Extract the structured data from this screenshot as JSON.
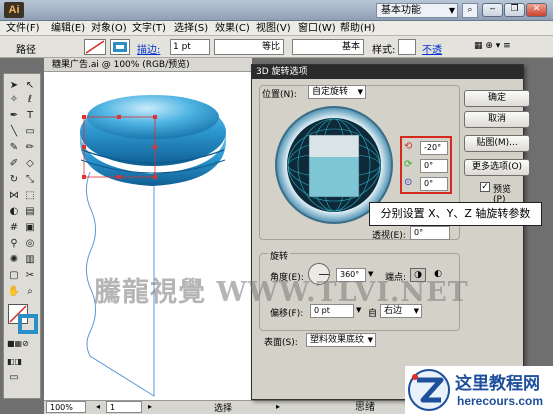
{
  "app": {
    "logo": "Ai",
    "workspace": "基本功能"
  },
  "menu": [
    "文件(F)",
    "编辑(E)",
    "对象(O)",
    "文字(T)",
    "选择(S)",
    "效果(C)",
    "视图(V)",
    "窗口(W)",
    "帮助(H)"
  ],
  "options": {
    "object_type": "路径",
    "stroke_label": "描边:",
    "stroke_weight": "1 pt",
    "profile": "等比",
    "brush": "基本",
    "style_label": "样式:",
    "opacity_link": "不透"
  },
  "document": {
    "tab_title": "糖果广告.ai @ 100% (RGB/预览)",
    "zoom": "100%",
    "page": "1",
    "status_tool": "选择"
  },
  "dialog": {
    "title": "3D 旋转选项",
    "position_label": "位置(N):",
    "position_value": "自定旋转",
    "x_value": "-20°",
    "y_value": "0°",
    "z_value": "0°",
    "perspective_label": "透视(E):",
    "perspective_value": "0°",
    "shading_section": "旋转",
    "angle_label": "角度(E):",
    "angle_value": "360°",
    "cap_label": "端点:",
    "bevel_label": "偏移(F):",
    "bevel_value": "0 pt",
    "bevel_from": "自",
    "bevel_side": "右边",
    "surface_label": "表面(S):",
    "surface_value": "塑料效果底纹",
    "buttons": {
      "ok": "确定",
      "cancel": "取消",
      "map": "贴图(M)...",
      "more": "更多选项(O)",
      "preview": "预览(P)"
    }
  },
  "callout": "分别设置 X、Y、Z 轴旋转参数",
  "watermark": "騰龍視覺 WWW.TLVI.NET",
  "bottom_partial": "思绪",
  "site_logo": {
    "title": "这里教程网",
    "url": "herecours.com"
  },
  "colors": {
    "accent": "#2b8fc6",
    "highlight": "#d42a1e",
    "path": "#5b9ad8"
  }
}
